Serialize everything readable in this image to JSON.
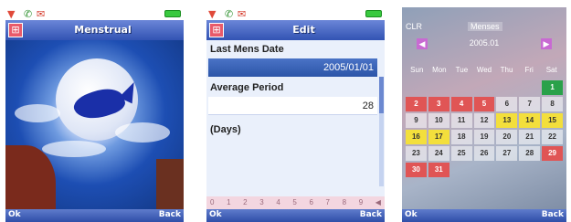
{
  "panel1": {
    "title": "Menstrual",
    "softkeys": {
      "left": "Ok",
      "right": "Back"
    }
  },
  "panel2": {
    "title": "Edit",
    "field1": {
      "label": "Last Mens Date",
      "value": "2005/01/01"
    },
    "field2": {
      "label": "Average Period",
      "value": "28"
    },
    "unit": "(Days)",
    "numbers": [
      "0",
      "1",
      "2",
      "3",
      "4",
      "5",
      "6",
      "7",
      "8",
      "9"
    ],
    "softkeys": {
      "left": "Ok",
      "right": "Back"
    }
  },
  "panel3": {
    "header_left": "CLR",
    "header_right": "Menses",
    "nav_label": "2005.01",
    "dow": [
      "Sun",
      "Mon",
      "Tue",
      "Wed",
      "Thu",
      "Fri",
      "Sat"
    ],
    "days": [
      {
        "d": "",
        "c": "empty"
      },
      {
        "d": "",
        "c": "empty"
      },
      {
        "d": "",
        "c": "empty"
      },
      {
        "d": "",
        "c": "empty"
      },
      {
        "d": "",
        "c": "empty"
      },
      {
        "d": "",
        "c": "empty"
      },
      {
        "d": "1",
        "c": "grn"
      },
      {
        "d": "2",
        "c": "red"
      },
      {
        "d": "3",
        "c": "red"
      },
      {
        "d": "4",
        "c": "red"
      },
      {
        "d": "5",
        "c": "red"
      },
      {
        "d": "6",
        "c": ""
      },
      {
        "d": "7",
        "c": ""
      },
      {
        "d": "8",
        "c": ""
      },
      {
        "d": "9",
        "c": ""
      },
      {
        "d": "10",
        "c": ""
      },
      {
        "d": "11",
        "c": ""
      },
      {
        "d": "12",
        "c": ""
      },
      {
        "d": "13",
        "c": "yel"
      },
      {
        "d": "14",
        "c": "yel"
      },
      {
        "d": "15",
        "c": "yel"
      },
      {
        "d": "16",
        "c": "yel"
      },
      {
        "d": "17",
        "c": "yel"
      },
      {
        "d": "18",
        "c": ""
      },
      {
        "d": "19",
        "c": ""
      },
      {
        "d": "20",
        "c": ""
      },
      {
        "d": "21",
        "c": ""
      },
      {
        "d": "22",
        "c": ""
      },
      {
        "d": "23",
        "c": ""
      },
      {
        "d": "24",
        "c": ""
      },
      {
        "d": "25",
        "c": ""
      },
      {
        "d": "26",
        "c": ""
      },
      {
        "d": "27",
        "c": ""
      },
      {
        "d": "28",
        "c": ""
      },
      {
        "d": "29",
        "c": "red"
      },
      {
        "d": "30",
        "c": "red"
      },
      {
        "d": "31",
        "c": "red"
      }
    ],
    "softkeys": {
      "left": "Ok",
      "right": "Back"
    }
  },
  "colors": {
    "title_bar": "#3253b3",
    "selected_field": "#2c55a8",
    "period_day": "#e05555",
    "fertile_day": "#f3df3c",
    "today": "#2aa14a"
  }
}
